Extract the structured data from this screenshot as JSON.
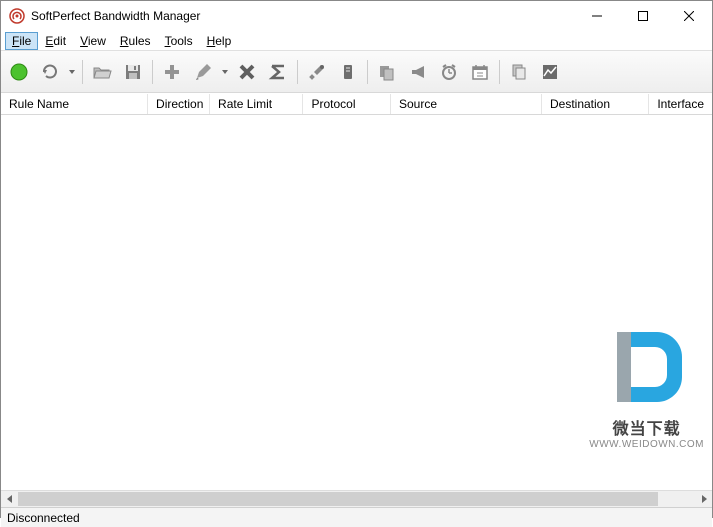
{
  "window": {
    "title": "SoftPerfect Bandwidth Manager"
  },
  "menu": {
    "file": "File",
    "edit": "Edit",
    "view": "View",
    "rules": "Rules",
    "tools": "Tools",
    "help": "Help"
  },
  "columns": {
    "rule_name": "Rule Name",
    "direction": "Direction",
    "rate_limit": "Rate Limit",
    "protocol": "Protocol",
    "source": "Source",
    "destination": "Destination",
    "interface": "Interface"
  },
  "status": {
    "text": "Disconnected"
  },
  "watermark": {
    "line1": "微当下载",
    "line2": "WWW.WEIDOWN.COM"
  },
  "toolbar_icons": {
    "connect": "connect",
    "refresh": "refresh",
    "open": "open",
    "save": "save",
    "add": "add",
    "edit": "edit",
    "delete": "delete",
    "sum": "sum",
    "settings": "settings",
    "monitor": "monitor",
    "filter": "filter",
    "announce": "announce",
    "alarm": "alarm",
    "schedule": "schedule",
    "copy": "copy",
    "chart": "chart"
  }
}
